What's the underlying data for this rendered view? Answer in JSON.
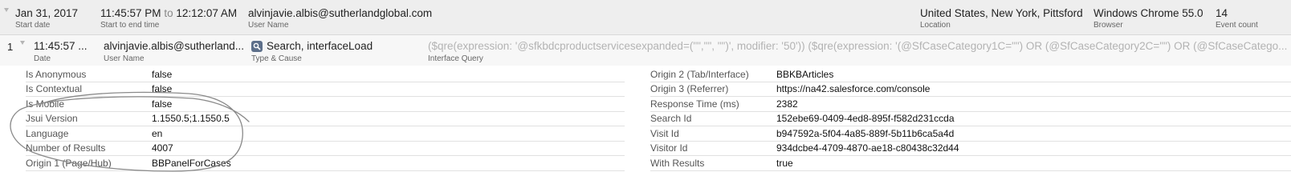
{
  "session": {
    "start_date": "Jan 31, 2017",
    "start_date_label": "Start date",
    "start_time": "11:45:57 PM",
    "to_word": "to",
    "end_time": "12:12:07 AM",
    "time_label": "Start to end time",
    "user_name": "alvinjavie.albis@sutherlandglobal.com",
    "user_name_label": "User Name",
    "location": "United States, New York, Pittsford",
    "location_label": "Location",
    "browser": "Windows Chrome 55.0",
    "browser_label": "Browser",
    "event_count": "14",
    "event_count_label": "Event count"
  },
  "event": {
    "index": "1",
    "date": "11:45:57 ...",
    "date_label": "Date",
    "user_name": "alvinjavie.albis@sutherland...",
    "user_name_label": "User Name",
    "type_cause": "Search, interfaceLoad",
    "type_cause_label": "Type & Cause",
    "type_icon": "search-icon",
    "interface_query": "($qre(expression: '@sfkbdcproductservicesexpanded=(\"\",\"\", \"\")', modifier: '50')) ($qre(expression: '(@SfCaseCategory1C=\"\") OR (@SfCaseCategory2C=\"\") OR (@SfCaseCatego...",
    "interface_query_label": "Interface Query"
  },
  "details_left": [
    {
      "key": "Is Anonymous",
      "value": "false"
    },
    {
      "key": "Is Contextual",
      "value": "false"
    },
    {
      "key": "Is Mobile",
      "value": "false"
    },
    {
      "key": "Jsui Version",
      "value": "1.1550.5;1.1550.5"
    },
    {
      "key": "Language",
      "value": "en"
    },
    {
      "key": "Number of Results",
      "value": "4007"
    },
    {
      "key": "Origin 1 (Page/Hub)",
      "value": "BBPanelForCases"
    }
  ],
  "details_right": [
    {
      "key": "Origin 2 (Tab/Interface)",
      "value": "BBKBArticles"
    },
    {
      "key": "Origin 3 (Referrer)",
      "value": "https://na42.salesforce.com/console"
    },
    {
      "key": "Response Time (ms)",
      "value": "2382"
    },
    {
      "key": "Search Id",
      "value": "152ebe69-0409-4ed8-895f-f582d231ccda"
    },
    {
      "key": "Visit Id",
      "value": "b947592a-5f04-4a85-889f-5b11b6ca5a4d"
    },
    {
      "key": "Visitor Id",
      "value": "934dcbe4-4709-4870-ae18-c80438c32d44"
    },
    {
      "key": "With Results",
      "value": "true"
    }
  ],
  "colors": {
    "session_bg": "#eeeeee",
    "event_bg": "#f7f7f7",
    "query_text": "#b3b3b3",
    "annotation_stroke": "#8a8a8a"
  }
}
